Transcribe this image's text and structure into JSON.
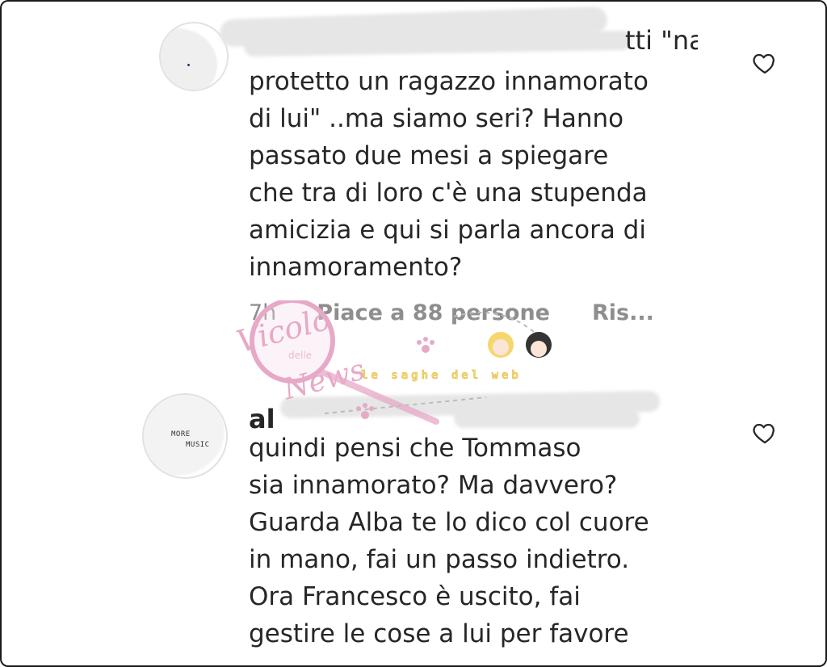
{
  "comments": [
    {
      "username_fragment": "tti \"na",
      "text": "protetto un ragazzo innamorato\ndi lui\" ..ma siamo seri? Hanno\npassato due mesi a spiegare\nche tra di loro c'è una stupenda\namicizia e qui si parla ancora di\ninnamoramento?",
      "time": "7h",
      "likes": "Piace a 88 persone",
      "reply": "Ris..."
    },
    {
      "username_fragment": "al",
      "avatar_text_1": "MORE",
      "avatar_text_2": "MUSIC",
      "text": "quindi pensi che Tommaso\nsia innamorato? Ma davvero?\nGuarda Alba te lo dico col cuore\nin mano, fai un passo indietro.\nOra Francesco è uscito, fai\ngestire le cose a lui per favore"
    }
  ],
  "watermark": {
    "brand": "Vicolo",
    "brand_small": "delle",
    "brand_end": "News",
    "tagline": "le saghe del web"
  },
  "icons": {
    "like": "heart-outline-icon"
  },
  "colors": {
    "text": "#262626",
    "meta": "#8e8e8e",
    "watermark_pink": "#e7a9c8",
    "watermark_yellow": "#f5d76e"
  }
}
